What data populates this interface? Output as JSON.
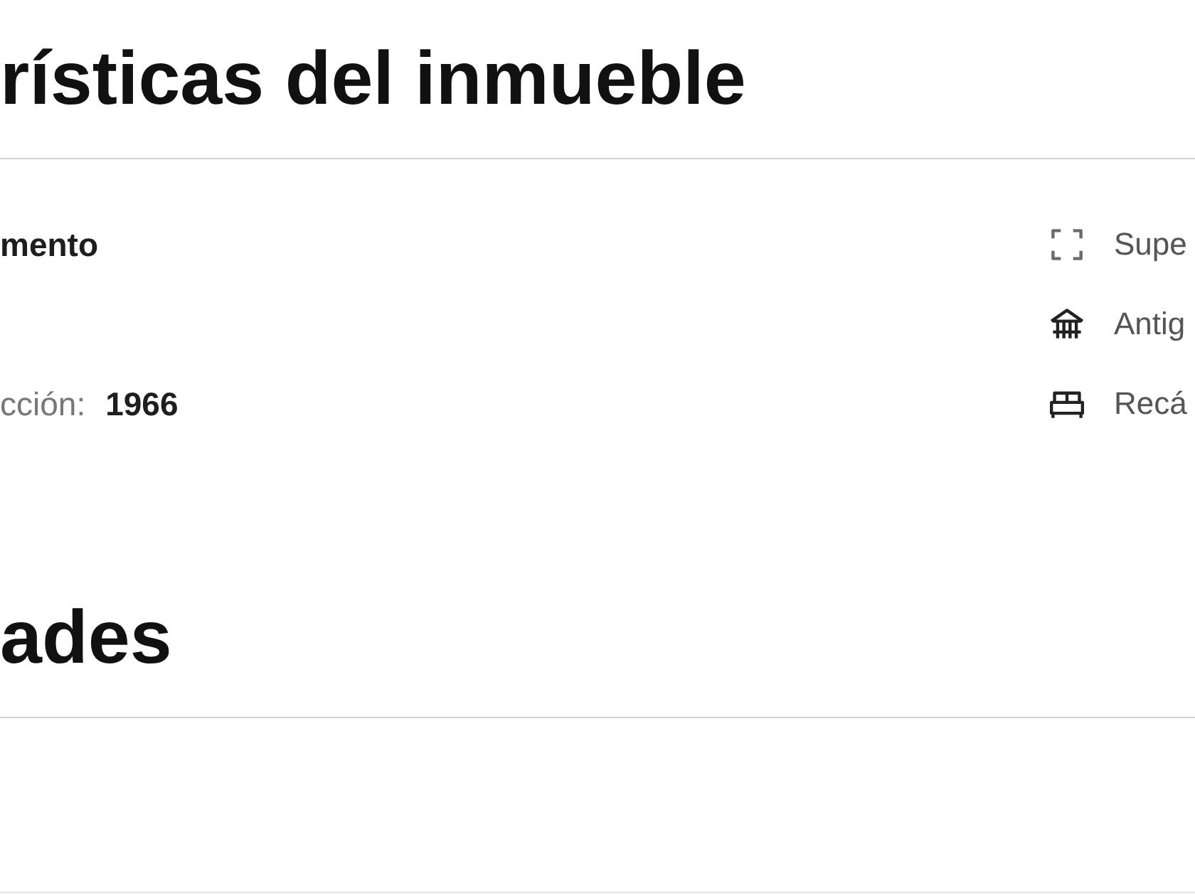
{
  "sections": [
    {
      "title": "rísticas del inmueble",
      "details": [
        {
          "value": "mento"
        },
        {
          "label": "cción:",
          "value": "1966"
        }
      ],
      "features": [
        {
          "kind": "area",
          "label": "Supe"
        },
        {
          "kind": "age",
          "label": "Antig"
        },
        {
          "kind": "bedrooms",
          "label": "Recá"
        }
      ]
    },
    {
      "title": "ades"
    }
  ]
}
